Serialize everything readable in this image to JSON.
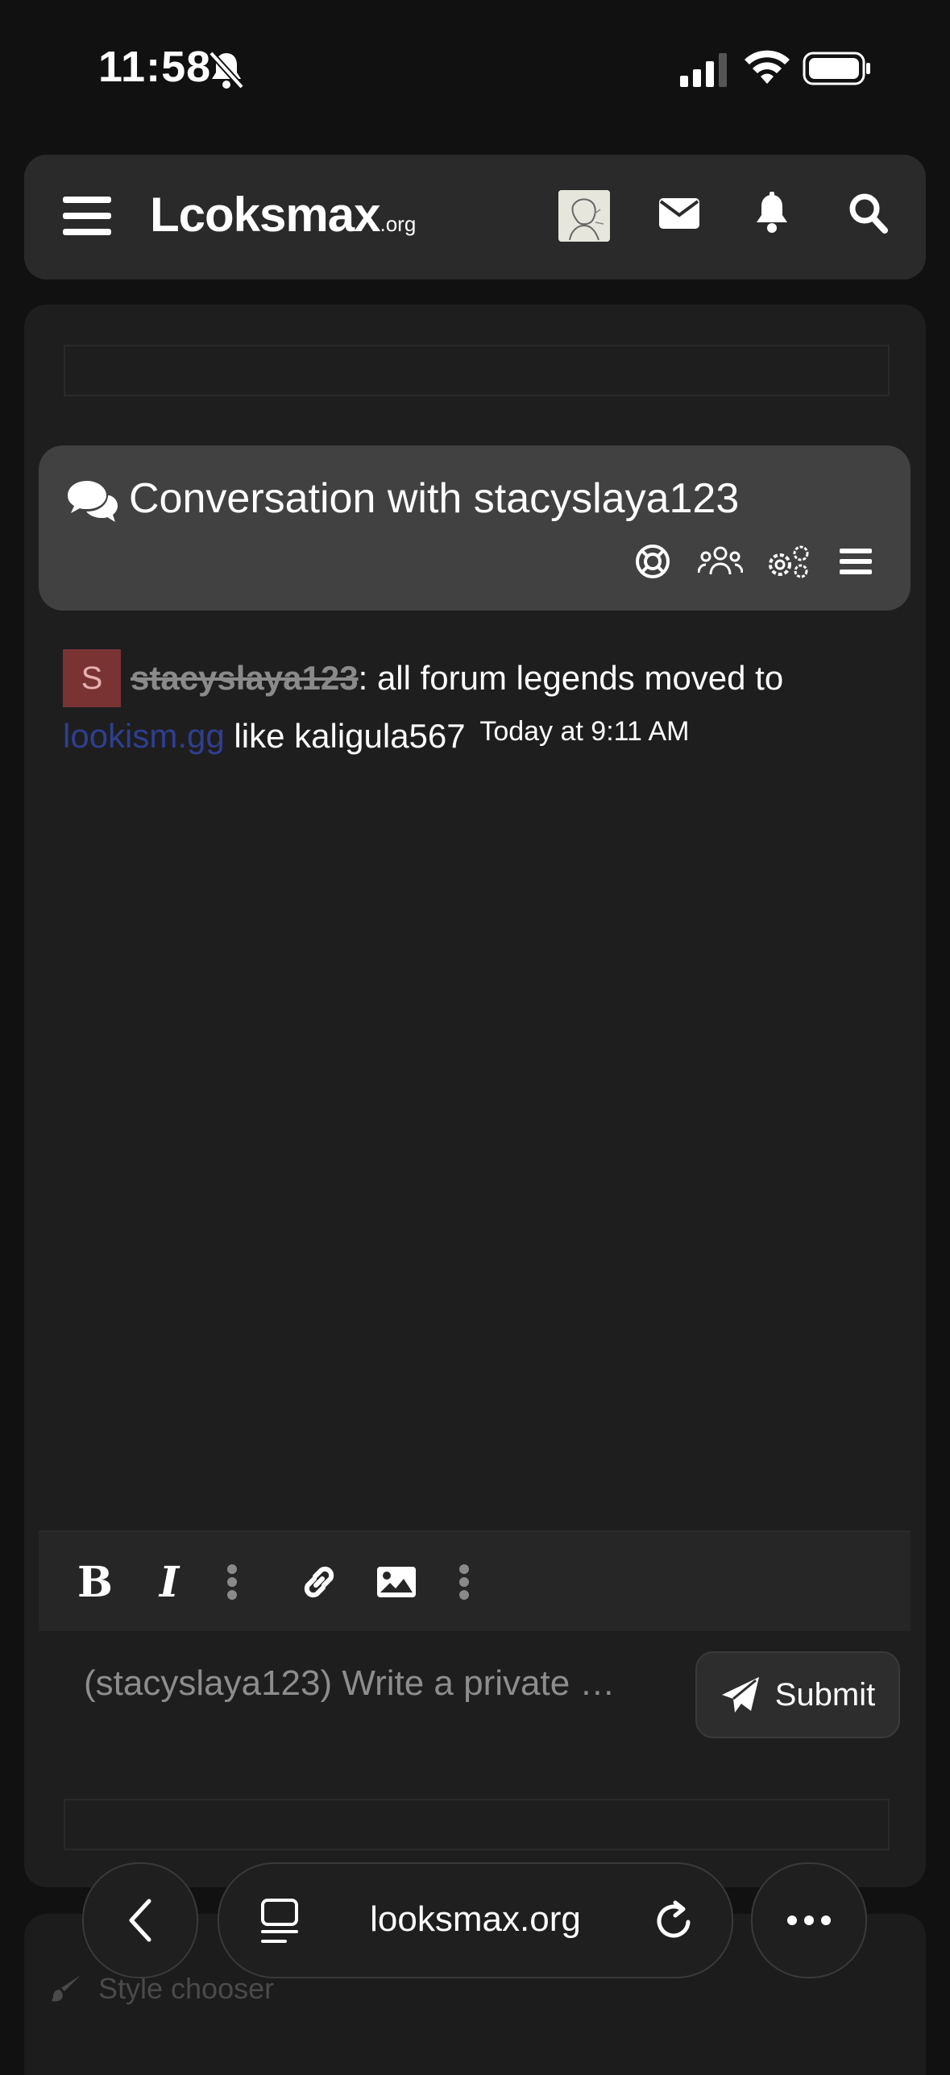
{
  "status_bar": {
    "time": "11:58"
  },
  "header": {
    "logo_main": "Lcoksmax",
    "logo_suffix": ".org"
  },
  "conversation": {
    "title": "Conversation with stacyslaya123",
    "tools": [
      "lifebuoy-icon",
      "users-icon",
      "cogs-icon",
      "menu-icon"
    ]
  },
  "message": {
    "avatar_letter": "S",
    "username": "stacyslaya123",
    "text_before_link": ": all forum legends moved to ",
    "link_text": "lookism.gg",
    "text_after_link": " like kaligula567",
    "timestamp": "Today at 9:11 AM"
  },
  "editor": {
    "toolbar": [
      "bold-icon",
      "italic-icon",
      "more-vertical-icon",
      "link-icon",
      "image-icon",
      "more-vertical-icon"
    ],
    "bold_label": "B",
    "italic_label": "I",
    "placeholder": "(stacyslaya123) Write a private …",
    "submit_label": "Submit"
  },
  "footer": {
    "style_chooser": "Style chooser"
  },
  "browser": {
    "url": "looksmax.org"
  },
  "colors": {
    "page_bg": "#111112",
    "panel_bg": "#1e1e1f",
    "conv_header_bg": "#414142",
    "link": "#2f3f8f",
    "avatar_bg": "#7a3333"
  }
}
